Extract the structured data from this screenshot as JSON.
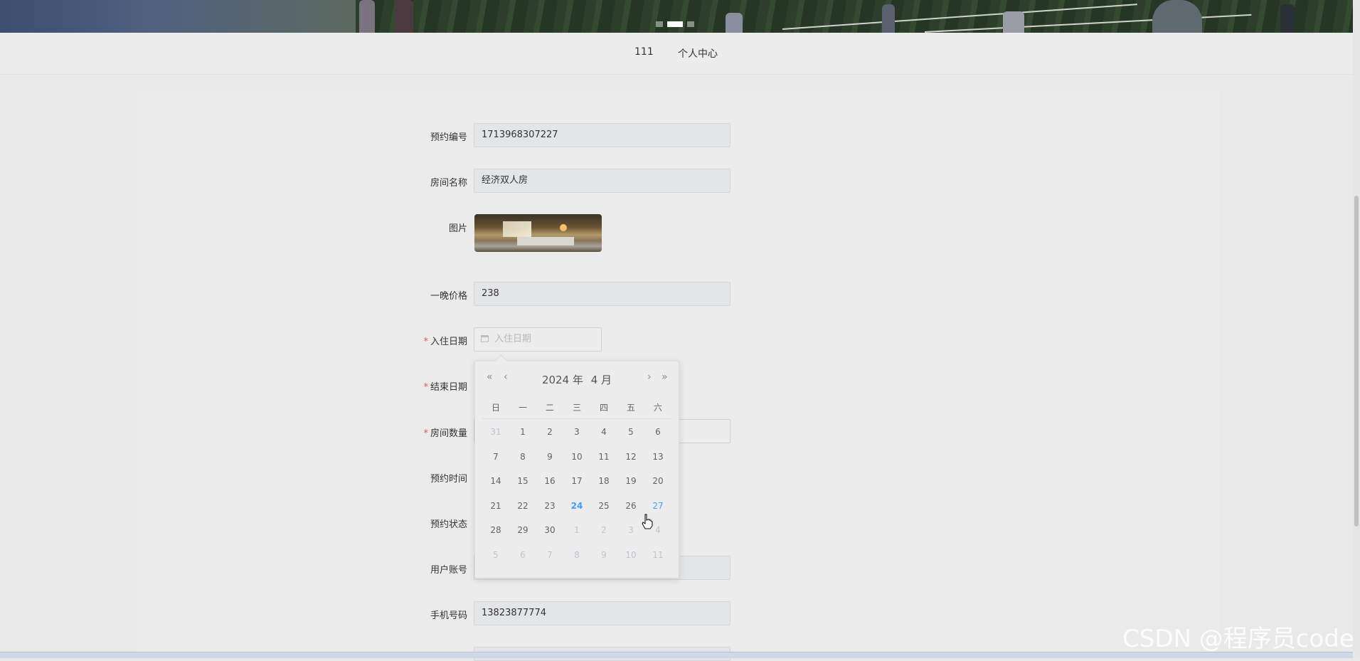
{
  "nav": {
    "items": [
      "111",
      "个人中心"
    ]
  },
  "form": {
    "booking_no": {
      "label": "预约编号",
      "value": "1713968307227"
    },
    "room_name": {
      "label": "房间名称",
      "value": "经济双人房"
    },
    "image": {
      "label": "图片"
    },
    "price": {
      "label": "一晚价格",
      "value": "238"
    },
    "checkin": {
      "label": "入住日期",
      "placeholder": "入住日期",
      "required_mark": "*"
    },
    "checkout": {
      "label": "结束日期",
      "required_mark": "*"
    },
    "room_count": {
      "label": "房间数量",
      "required_mark": "*"
    },
    "booking_time": {
      "label": "预约时间"
    },
    "status": {
      "label": "预约状态"
    },
    "account": {
      "label": "用户账号"
    },
    "phone": {
      "label": "手机号码",
      "value": "13823877774"
    }
  },
  "calendar": {
    "year_label": "2024 年",
    "month_label": "4 月",
    "prev_year": "«",
    "prev_month": "‹",
    "next_month": "›",
    "next_year": "»",
    "weekdays": [
      "日",
      "一",
      "二",
      "三",
      "四",
      "五",
      "六"
    ],
    "weeks": [
      [
        "31",
        "1",
        "2",
        "3",
        "4",
        "5",
        "6"
      ],
      [
        "7",
        "8",
        "9",
        "10",
        "11",
        "12",
        "13"
      ],
      [
        "14",
        "15",
        "16",
        "17",
        "18",
        "19",
        "20"
      ],
      [
        "21",
        "22",
        "23",
        "24",
        "25",
        "26",
        "27"
      ],
      [
        "28",
        "29",
        "30",
        "1",
        "2",
        "3",
        "4"
      ],
      [
        "5",
        "6",
        "7",
        "8",
        "9",
        "10",
        "11"
      ]
    ],
    "today": "24",
    "hovered": "27"
  },
  "watermark": "CSDN @程序员code",
  "colors": {
    "accent": "#409eff",
    "required": "#e5534b"
  }
}
